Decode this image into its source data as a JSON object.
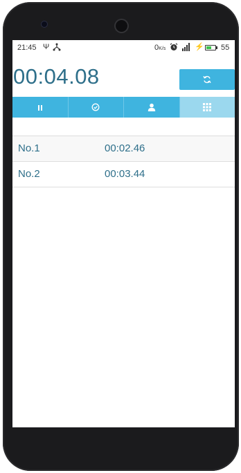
{
  "status_bar": {
    "time": "21:45",
    "usb_icon": "usb-icon",
    "share_icon": "share-icon",
    "data_rate": "0",
    "data_rate_unit": "K/s",
    "alarm_icon": "alarm-icon",
    "signal_icon": "signal-icon",
    "charging_icon": "charging-icon",
    "battery_percent": "55",
    "battery_level": 0.55
  },
  "stopwatch": {
    "elapsed": "00:04.08",
    "reset_icon": "refresh-icon"
  },
  "tabs": [
    {
      "icon": "pause-icon",
      "active": false
    },
    {
      "icon": "check-circle-icon",
      "active": false
    },
    {
      "icon": "person-icon",
      "active": false
    },
    {
      "icon": "grid-icon",
      "active": true
    }
  ],
  "laps": [
    {
      "label": "No.1",
      "time": "00:02.46"
    },
    {
      "label": "No.2",
      "time": "00:03.44"
    }
  ],
  "colors": {
    "accent": "#3fb4df",
    "accent_active": "#9bd8ee",
    "text": "#2e6f8a",
    "phone_body": "#1b1b1d"
  }
}
